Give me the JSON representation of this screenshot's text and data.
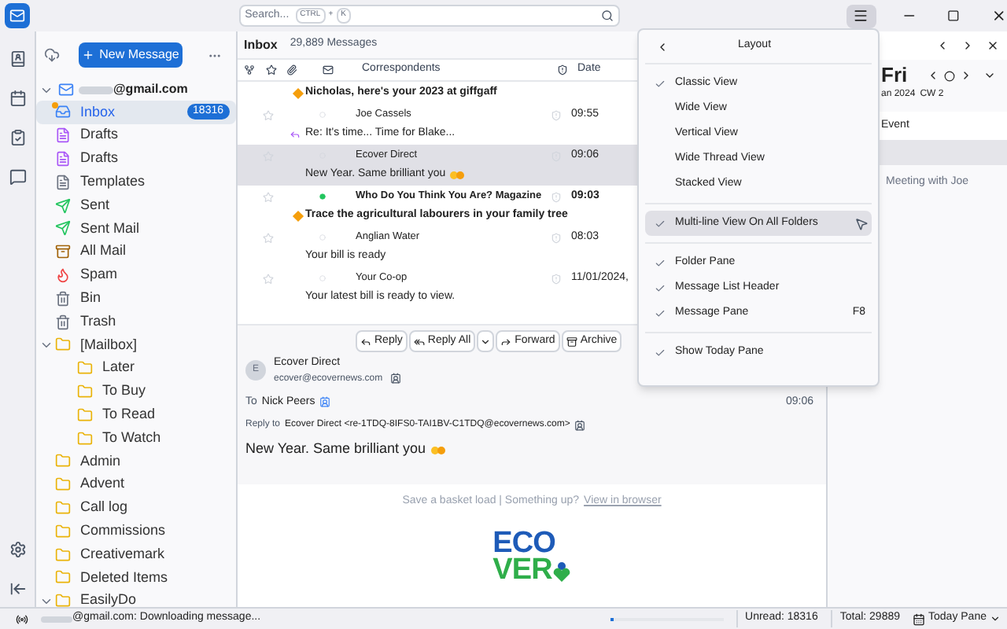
{
  "search": {
    "placeholder": "Search...",
    "shortcut": [
      "CTRL",
      "+",
      "K"
    ]
  },
  "folder_pane": {
    "new_message": "New Message",
    "account": "@gmail.com",
    "folders": [
      {
        "name": "Inbox",
        "kind": "inbox",
        "selected": true,
        "badge": "18316",
        "new": true
      },
      {
        "name": "Drafts",
        "kind": "drafts",
        "selected": false
      },
      {
        "name": "Drafts",
        "kind": "drafts",
        "selected": false
      },
      {
        "name": "Templates",
        "kind": "templates",
        "selected": false
      },
      {
        "name": "Sent",
        "kind": "sent",
        "selected": false
      },
      {
        "name": "Sent Mail",
        "kind": "sent",
        "selected": false
      },
      {
        "name": "All Mail",
        "kind": "allmail",
        "selected": false
      },
      {
        "name": "Spam",
        "kind": "spam",
        "selected": false
      },
      {
        "name": "Bin",
        "kind": "trash",
        "selected": false
      },
      {
        "name": "Trash",
        "kind": "trash",
        "selected": false
      },
      {
        "name": "[Mailbox]",
        "kind": "folder",
        "selected": false,
        "expanded": true,
        "children": [
          {
            "name": "Later",
            "kind": "folder",
            "selected": false
          },
          {
            "name": "To Buy",
            "kind": "folder",
            "selected": false
          },
          {
            "name": "To Read",
            "kind": "folder",
            "selected": false
          },
          {
            "name": "To Watch",
            "kind": "folder",
            "selected": false
          }
        ]
      },
      {
        "name": "Admin",
        "kind": "folder",
        "selected": false
      },
      {
        "name": "Advent",
        "kind": "folder",
        "selected": false
      },
      {
        "name": "Call log",
        "kind": "folder",
        "selected": false
      },
      {
        "name": "Commissions",
        "kind": "folder",
        "selected": false
      },
      {
        "name": "Creativemark",
        "kind": "folder",
        "selected": false
      },
      {
        "name": "Deleted Items",
        "kind": "folder",
        "selected": false
      },
      {
        "name": "EasilyDo",
        "kind": "folder",
        "selected": false,
        "expanded": true
      }
    ]
  },
  "message_list": {
    "folder": "Inbox",
    "count": "29,889 Messages",
    "columns": [
      "Correspondents",
      "Date"
    ],
    "rows": [
      {
        "subject": "Nicholas, here's your 2023 at giffgaff",
        "unread": true,
        "new": true,
        "selected": false
      },
      {
        "correspondent": "Joe Cassels",
        "date": "09:55",
        "subject": "Re: It's time... Time for Blake...",
        "unread": false,
        "new": false,
        "replied": true,
        "selected": false
      },
      {
        "correspondent": "Ecover Direct",
        "date": "09:06",
        "subject": "New Year. Same brilliant you",
        "emoji": true,
        "unread": false,
        "new": false,
        "selected": true
      },
      {
        "correspondent": "Who Do You Think You Are? Magazine",
        "date": "09:03",
        "subject": "Trace the agricultural labourers in your family tree",
        "unread": true,
        "new": true,
        "selected": false
      },
      {
        "correspondent": "Anglian Water",
        "date": "08:03",
        "subject": "Your bill is ready",
        "unread": false,
        "new": false,
        "selected": false
      },
      {
        "correspondent": "Your Co-op",
        "date": "11/01/2024,",
        "subject": "Your latest bill is ready to view.",
        "unread": false,
        "new": false,
        "selected": false
      }
    ]
  },
  "message_header": {
    "buttons": [
      "Reply",
      "Reply All",
      "Forward",
      "Archive"
    ],
    "avatar": "E",
    "from_name": "Ecover Direct",
    "from_email": "ecover@ecovernews.com",
    "to_label": "To",
    "to": "Nick Peers",
    "time": "09:06",
    "reply_to_label": "Reply to",
    "reply_to": "Ecover Direct <re-1TDQ-8IFS0-TAI1BV-C1TDQ@ecovernews.com>",
    "subject": "New Year. Same brilliant you"
  },
  "message_body": {
    "preheader": "Save a basket load | Something up?",
    "link": "View in browser",
    "logo": [
      "ECO",
      "VER"
    ]
  },
  "today_pane": {
    "day": "Fri",
    "date": "an 2024",
    "week": "CW 2",
    "new_event": "Event",
    "events": [
      "Meeting with Joe"
    ]
  },
  "layout_menu": {
    "title": "Layout",
    "sections": [
      [
        {
          "label": "Classic View",
          "checked": true,
          "highlighted": false
        },
        {
          "label": "Wide View",
          "checked": false,
          "highlighted": false
        },
        {
          "label": "Vertical View",
          "checked": false,
          "highlighted": false
        },
        {
          "label": "Wide Thread View",
          "checked": false,
          "highlighted": false
        },
        {
          "label": "Stacked View",
          "checked": false,
          "highlighted": false
        }
      ],
      [
        {
          "label": "Multi-line View On All Folders",
          "checked": true,
          "highlighted": true
        }
      ],
      [
        {
          "label": "Folder Pane",
          "checked": true,
          "highlighted": false
        },
        {
          "label": "Message List Header",
          "checked": true,
          "highlighted": false
        },
        {
          "label": "Message Pane",
          "checked": true,
          "highlighted": false,
          "shortcut": "F8"
        }
      ],
      [
        {
          "label": "Show Today Pane",
          "checked": true,
          "highlighted": false
        }
      ]
    ]
  },
  "status_bar": {
    "account": "@gmail.com: Downloading message...",
    "level": 0.02,
    "unread": "Unread: 18316",
    "total": "Total: 29889",
    "today_pane": "Today Pane"
  }
}
